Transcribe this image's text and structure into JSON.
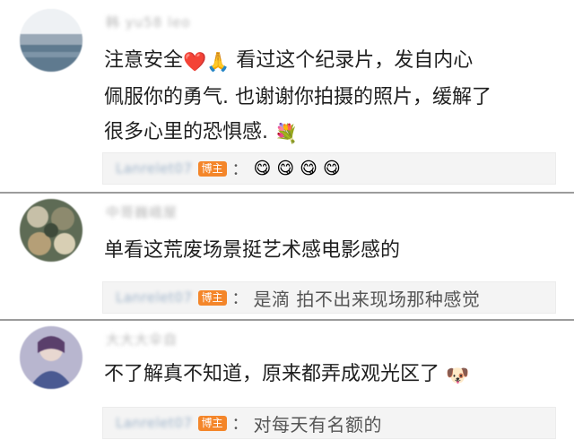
{
  "comments": [
    {
      "username": "韩 yu58 leo",
      "text_line1": "注意安全",
      "text_line1_emoji": "❤️🙏",
      "text_line1_rest": " 看过这个纪录片，发自内心",
      "text_line2": "佩服你的勇气. 也谢谢你拍摄的照片，缓解了",
      "text_line3": "很多心里的恐惧感.",
      "text_line3_emoji": "💐",
      "reply": {
        "name": "Lanrelet07",
        "badge": "博主",
        "colon": "：",
        "emojis": [
          "😋",
          "😋",
          "😋",
          "😋"
        ]
      }
    },
    {
      "username": "中哥巍峨屋",
      "text_line1": "单看这荒废场景挺艺术感电影感的",
      "reply": {
        "name": "Lanrelet07",
        "badge": "博主",
        "colon": "：",
        "text": "是滴 拍不出来现场那种感觉"
      }
    },
    {
      "username": "大大大伞自",
      "text_line1": "不了解真不知道，原来都弄成观光区了",
      "text_line1_emoji": "🐶",
      "reply": {
        "name": "Lanrelet07",
        "badge": "博主",
        "colon": "：",
        "text": "对每天有名额的"
      }
    }
  ],
  "colors": {
    "divider": "#9c9c9c",
    "badge": "#f4862a",
    "reply_bg": "#f4f4f4"
  }
}
